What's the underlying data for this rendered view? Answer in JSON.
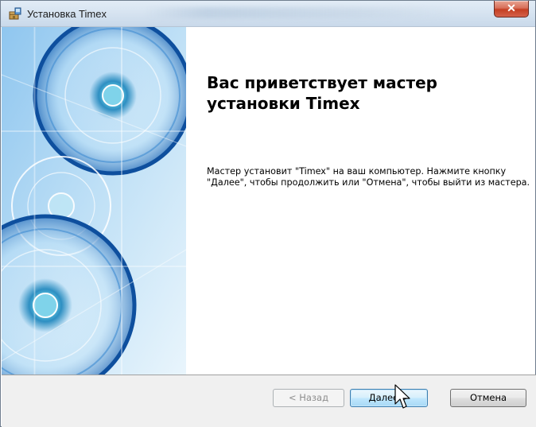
{
  "window": {
    "title": "Установка Timex",
    "close_label": "✕",
    "app_icon": "installer-package-icon"
  },
  "welcome": {
    "heading": "Вас приветствует мастер установки Timex",
    "description": "Мастер установит \"Timex\" на ваш компьютер. Нажмите кнопку \"Далее\", чтобы продолжить или \"Отмена\", чтобы выйти из мастера."
  },
  "buttons": {
    "back": "< Назад",
    "next": "Далее >",
    "cancel": "Отмена"
  },
  "colors": {
    "panel_blue": "#1e6fc4",
    "accent_cyan": "#3ab0d8",
    "button_focus": "#3c7fb1"
  }
}
